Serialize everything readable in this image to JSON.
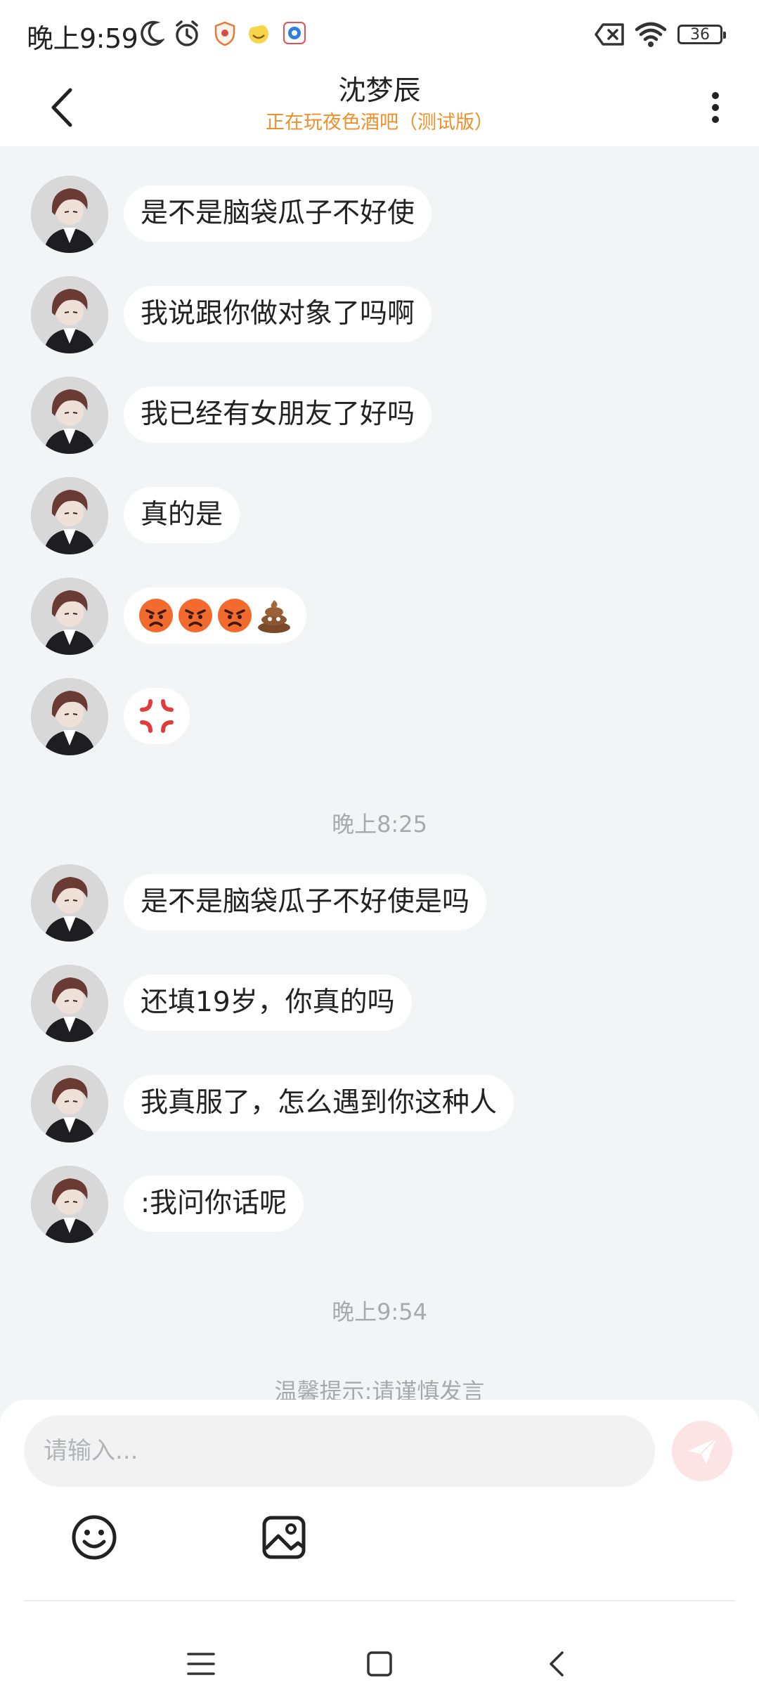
{
  "status_bar": {
    "time": "晚上9:59",
    "battery": "36",
    "icons": [
      "moon-icon",
      "alarm-icon",
      "shield-app-icon",
      "emoji-app-icon",
      "browser-app-icon",
      "no-sim-icon",
      "wifi-icon",
      "battery-icon"
    ]
  },
  "header": {
    "back_icon": "chevron-left-icon",
    "title": "沈梦辰",
    "subtitle": "正在玩夜色酒吧（测试版）",
    "more_icon": "more-vertical-icon"
  },
  "messages": [
    {
      "text": "是不是脑袋瓜子不好使"
    },
    {
      "text": "我说跟你做对象了吗啊"
    },
    {
      "text": "我已经有女朋友了好吗"
    },
    {
      "text": "真的是"
    },
    {
      "emojis": [
        "angry-face",
        "angry-face",
        "angry-face",
        "pile-of-poo"
      ]
    },
    {
      "emojis": [
        "anger-symbol"
      ]
    },
    {
      "text": "是不是脑袋瓜子不好使是吗"
    },
    {
      "text": "还填19岁，你真的吗"
    },
    {
      "text": "我真服了，怎么遇到你这种人"
    },
    {
      "text": ":我问你话呢"
    }
  ],
  "time_separators": [
    "晚上8:25",
    "晚上9:54"
  ],
  "tip": "温馨提示:请谨慎发言",
  "input": {
    "placeholder": "请输入..."
  },
  "toolbar": {
    "emoji_icon": "smiley-icon",
    "image_icon": "image-icon",
    "send_icon": "paper-plane-icon"
  },
  "nav": {
    "menu_icon": "menu-icon",
    "home_icon": "home-square-icon",
    "back_icon": "back-triangle-icon"
  },
  "colors": {
    "accent": "#f0902a",
    "send_bg": "#fde4e4",
    "background": "#f3f4f6"
  }
}
